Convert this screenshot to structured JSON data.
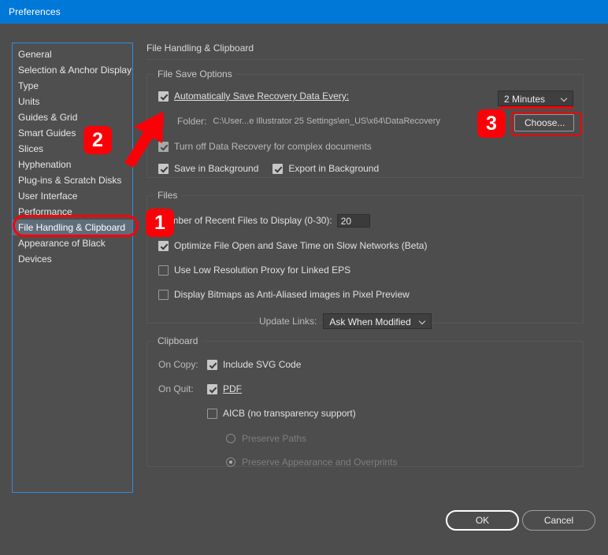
{
  "window": {
    "title": "Preferences"
  },
  "sidebar": {
    "items": [
      {
        "label": "General",
        "selected": false
      },
      {
        "label": "Selection & Anchor Display",
        "selected": false
      },
      {
        "label": "Type",
        "selected": false
      },
      {
        "label": "Units",
        "selected": false
      },
      {
        "label": "Guides & Grid",
        "selected": false
      },
      {
        "label": "Smart Guides",
        "selected": false
      },
      {
        "label": "Slices",
        "selected": false
      },
      {
        "label": "Hyphenation",
        "selected": false
      },
      {
        "label": "Plug-ins & Scratch Disks",
        "selected": false
      },
      {
        "label": "User Interface",
        "selected": false
      },
      {
        "label": "Performance",
        "selected": false
      },
      {
        "label": "File Handling & Clipboard",
        "selected": true
      },
      {
        "label": "Appearance of Black",
        "selected": false
      },
      {
        "label": "Devices",
        "selected": false
      }
    ]
  },
  "panel": {
    "title": "File Handling & Clipboard",
    "file_save_options": {
      "legend": "File Save Options",
      "auto_save_label": "Automatically Save Recovery Data Every:",
      "auto_save_checked": true,
      "interval_value": "2 Minutes",
      "folder_label": "Folder:",
      "folder_path": "C:\\User...e Illustrator 25 Settings\\en_US\\x64\\DataRecovery",
      "choose_button": "Choose...",
      "turn_off_label": "Turn off Data Recovery for complex documents",
      "turn_off_checked": true,
      "save_background_label": "Save in Background",
      "save_background_checked": true,
      "export_background_label": "Export in Background",
      "export_background_checked": true
    },
    "files": {
      "legend": "Files",
      "recent_files_label": "Number of Recent Files to Display (0-30):",
      "recent_files_value": "20",
      "optimize_label": "Optimize File Open and Save Time on Slow Networks (Beta)",
      "optimize_checked": true,
      "low_res_label": "Use Low Resolution Proxy for Linked EPS",
      "low_res_checked": false,
      "display_bitmaps_label": "Display Bitmaps as Anti-Aliased images in Pixel Preview",
      "display_bitmaps_checked": false,
      "update_links_label": "Update Links:",
      "update_links_value": "Ask When Modified"
    },
    "clipboard": {
      "legend": "Clipboard",
      "on_copy_label": "On Copy:",
      "include_svg_label": "Include SVG Code",
      "include_svg_checked": true,
      "on_quit_label": "On Quit:",
      "pdf_label": "PDF",
      "pdf_checked": true,
      "aicb_label": "AICB (no transparency support)",
      "aicb_checked": false,
      "preserve_paths_label": "Preserve Paths",
      "preserve_paths_selected": false,
      "preserve_appearance_label": "Preserve Appearance and Overprints",
      "preserve_appearance_selected": true
    }
  },
  "footer": {
    "ok_label": "OK",
    "cancel_label": "Cancel"
  },
  "annotations": {
    "badge_1": "1",
    "badge_2": "2",
    "badge_3": "3",
    "marker_color": "#fb0007"
  },
  "colors": {
    "titlebar": "#0078d7",
    "dialog_background": "#4d4d4d",
    "sidebar_border": "#2d8ce0",
    "selection": "#5f6d7a"
  }
}
